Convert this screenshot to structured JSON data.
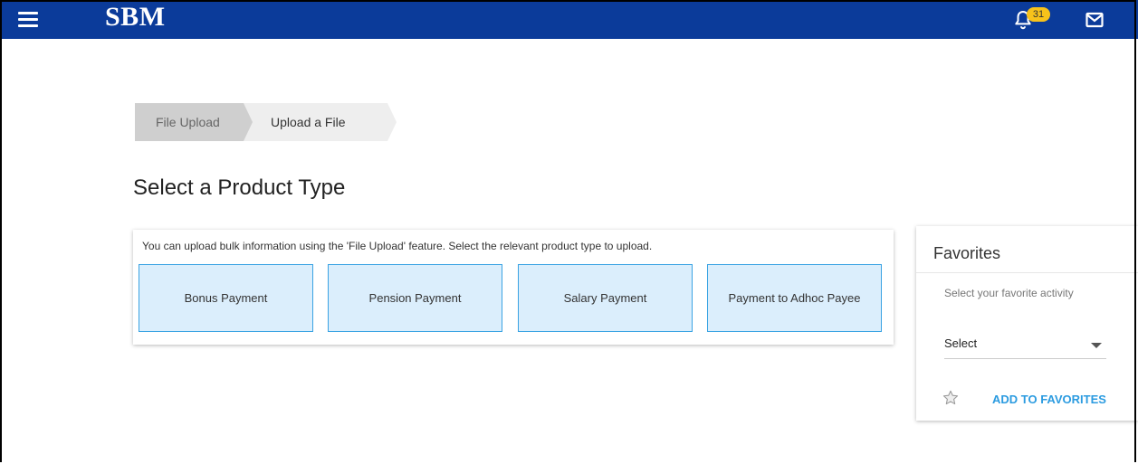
{
  "header": {
    "logo": "SBM",
    "notification_count": "31",
    "colors": {
      "bar": "#0b3b9a",
      "badge": "#f7c21b"
    }
  },
  "breadcrumb": {
    "items": [
      {
        "label": "File Upload"
      },
      {
        "label": "Upload a File"
      }
    ]
  },
  "main": {
    "title": "Select a Product Type",
    "intro": "You can upload bulk information using the 'File Upload' feature. Select the relevant product type to upload.",
    "products": [
      {
        "label": "Bonus Payment"
      },
      {
        "label": "Pension Payment"
      },
      {
        "label": "Salary Payment"
      },
      {
        "label": "Payment to Adhoc Payee"
      }
    ]
  },
  "favorites": {
    "title": "Favorites",
    "hint": "Select your favorite activity",
    "select_value": "Select",
    "add_label": "ADD TO FAVORITES",
    "accent": "#2b9be0"
  },
  "icons": {
    "menu": "hamburger-menu-icon",
    "bell": "bell-icon",
    "mail": "mail-icon",
    "star": "star-icon",
    "caret": "chevron-down-icon"
  }
}
